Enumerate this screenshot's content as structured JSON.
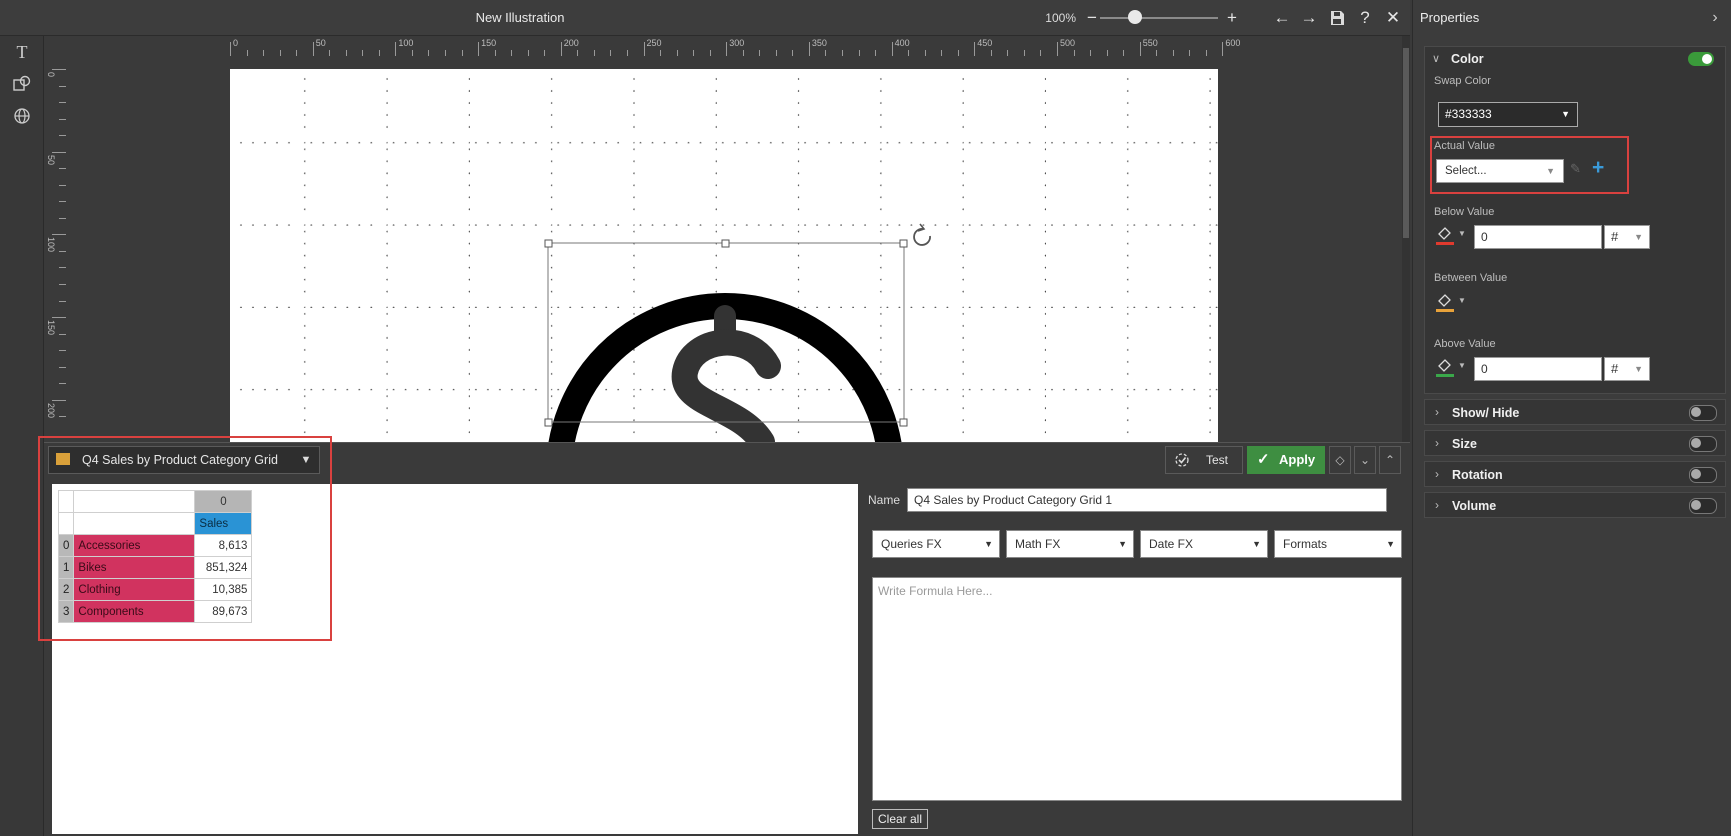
{
  "window": {
    "title": "New Illustration"
  },
  "zoom": {
    "label": "100%",
    "minus": "−",
    "plus": "+",
    "level_percent": 100
  },
  "toolbar": {
    "back": "←",
    "forward": "→",
    "help": "?",
    "close": "✕"
  },
  "left_tools": {
    "text": "T"
  },
  "ruler": {
    "h_labels": [
      "0",
      "50",
      "100",
      "150",
      "200",
      "250",
      "300",
      "350",
      "400",
      "450",
      "500",
      "550",
      "600"
    ],
    "v_labels": [
      "0",
      "50",
      "100",
      "150",
      "200"
    ]
  },
  "source": {
    "label": "Q4 Sales by Product Category Grid"
  },
  "grid": {
    "column_index": "0",
    "column_header": "Sales",
    "rows": [
      {
        "index": "0",
        "category": "Accessories",
        "value": "8,613"
      },
      {
        "index": "1",
        "category": "Bikes",
        "value": "851,324"
      },
      {
        "index": "2",
        "category": "Clothing",
        "value": "10,385"
      },
      {
        "index": "3",
        "category": "Components",
        "value": "89,673"
      }
    ]
  },
  "actions": {
    "test": "Test",
    "apply": "Apply"
  },
  "formula": {
    "name_label": "Name",
    "name_value": "Q4 Sales by Product Category Grid 1",
    "dropdowns": [
      "Queries FX",
      "Math FX",
      "Date FX",
      "Formats"
    ],
    "placeholder": "Write Formula Here...",
    "clear_all": "Clear all"
  },
  "properties": {
    "title": "Properties",
    "color": {
      "header": "Color",
      "swap_label": "Swap Color",
      "swap_value": "#333333",
      "actual_label": "Actual Value",
      "actual_value": "Select...",
      "below_label": "Below Value",
      "below_value": "0",
      "between_label": "Between Value",
      "above_label": "Above Value",
      "above_value": "0",
      "format_symbol": "#"
    },
    "sections": [
      "Show/ Hide",
      "Size",
      "Rotation",
      "Volume"
    ]
  },
  "colors": {
    "accent_green": "#3e8e41",
    "category_fill": "#d1335f",
    "header_blue": "#2a93d5",
    "highlight_red": "#d9413f"
  }
}
